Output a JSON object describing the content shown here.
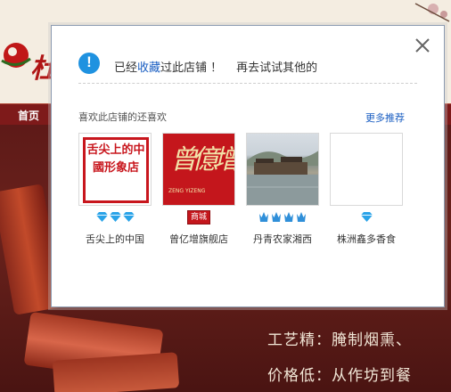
{
  "background": {
    "logo_text": "杜",
    "nav_home": "首页",
    "promo_lines": [
      "工艺精：腌制烟熏、",
      "价格低：从作坊到餐"
    ]
  },
  "dialog": {
    "message": {
      "pre": "已经",
      "highlight": "收藏",
      "post": "过此店铺 ！",
      "tail": "再去试试其他的"
    },
    "section_title": "喜欢此店铺的还喜欢",
    "more_link": "更多推荐",
    "shops": [
      {
        "name": "舌尖上的中国",
        "thumb_text": "舌尖上的中國形象店",
        "badge": "diamond",
        "level": 3
      },
      {
        "name": "曾亿增旗舰店",
        "thumb_text": "曾億增",
        "thumb_sub": "ZENG YIZENG",
        "badge": "mall",
        "badge_text": "商城"
      },
      {
        "name": "丹青农家湘西",
        "badge": "crown",
        "level": 4
      },
      {
        "name": "株洲鑫多香食",
        "badge": "diamond",
        "level": 1
      }
    ]
  },
  "colors": {
    "accent_blue": "#1a5ec2",
    "info_icon": "#1f92e0",
    "mall_red": "#c4161c",
    "diamond": "#2aa3e8",
    "crown": "#2f8fd9"
  }
}
